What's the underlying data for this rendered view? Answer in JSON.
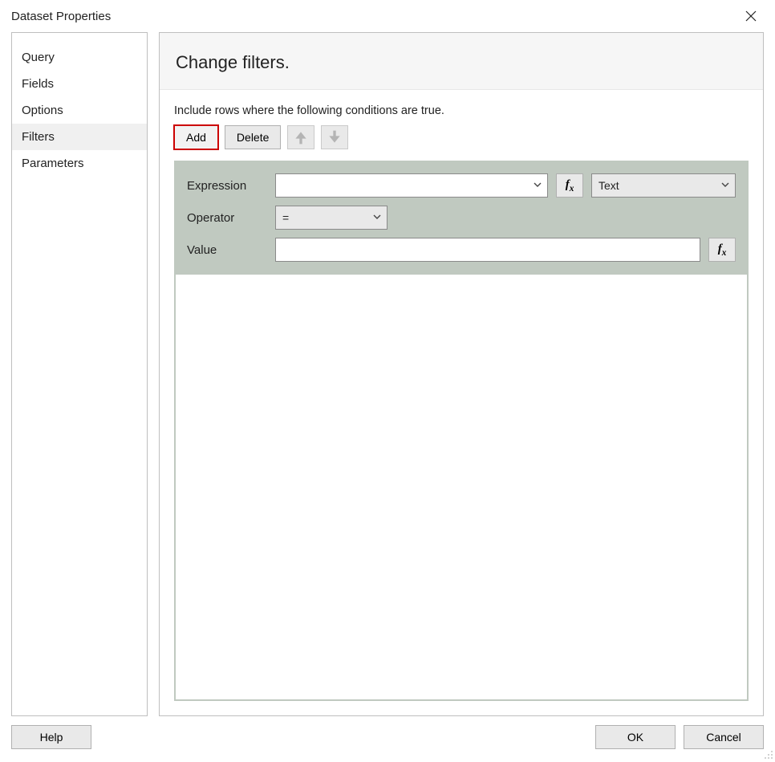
{
  "window": {
    "title": "Dataset Properties"
  },
  "sidebar": {
    "items": [
      {
        "label": "Query"
      },
      {
        "label": "Fields"
      },
      {
        "label": "Options"
      },
      {
        "label": "Filters"
      },
      {
        "label": "Parameters"
      }
    ],
    "selected_index": 3
  },
  "panel": {
    "heading": "Change filters.",
    "instruction": "Include rows where the following conditions are true."
  },
  "toolbar": {
    "add_label": "Add",
    "delete_label": "Delete"
  },
  "filter": {
    "expression_label": "Expression",
    "expression_value": "",
    "type_value": "Text",
    "operator_label": "Operator",
    "operator_value": "=",
    "value_label": "Value",
    "value_value": ""
  },
  "footer": {
    "help_label": "Help",
    "ok_label": "OK",
    "cancel_label": "Cancel"
  }
}
